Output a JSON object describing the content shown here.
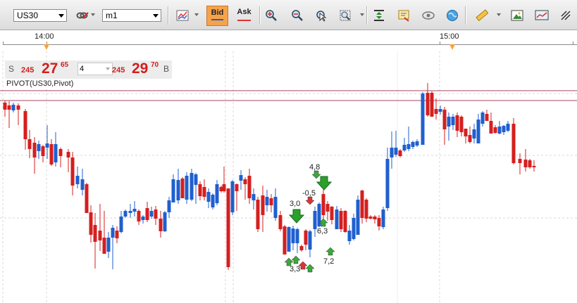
{
  "toolbar": {
    "symbol": "US30",
    "timeframe": "m1",
    "bid_label": "Bid",
    "ask_label": "Ask",
    "icons": [
      "link-icon",
      "chart-type-icon",
      "zoom-in-icon",
      "zoom-out-icon",
      "cursor-icon",
      "zoom-area-icon",
      "fit-icon",
      "settings-icon",
      "eye-icon",
      "globe-icon",
      "ruler-icon",
      "image-icon",
      "screenshot-icon",
      "draw-icon"
    ]
  },
  "time_axis": {
    "labels": [
      "14:00",
      "15:00"
    ]
  },
  "quote": {
    "sell_label": "S",
    "sell_small": "245",
    "sell_big": "27",
    "sell_sup": "65",
    "quantity": "4",
    "buy_small": "245",
    "buy_big": "29",
    "buy_sup": "70",
    "buy_label": "B"
  },
  "indicator_label": "PIVOT(US30,Pivot)",
  "colors": {
    "up": "#1f5fcf",
    "down": "#d51f1f",
    "pivot": "#a8445c",
    "accent": "#f5a23b"
  },
  "signals": [
    {
      "text": "4,8",
      "kind": "down"
    },
    {
      "text": "-0,5",
      "kind": "down"
    },
    {
      "text": "3,0",
      "kind": "down"
    },
    {
      "text": "6,3",
      "kind": "up"
    },
    {
      "text": "7,2",
      "kind": "up"
    },
    {
      "text": "3,3",
      "kind": "up"
    }
  ]
}
